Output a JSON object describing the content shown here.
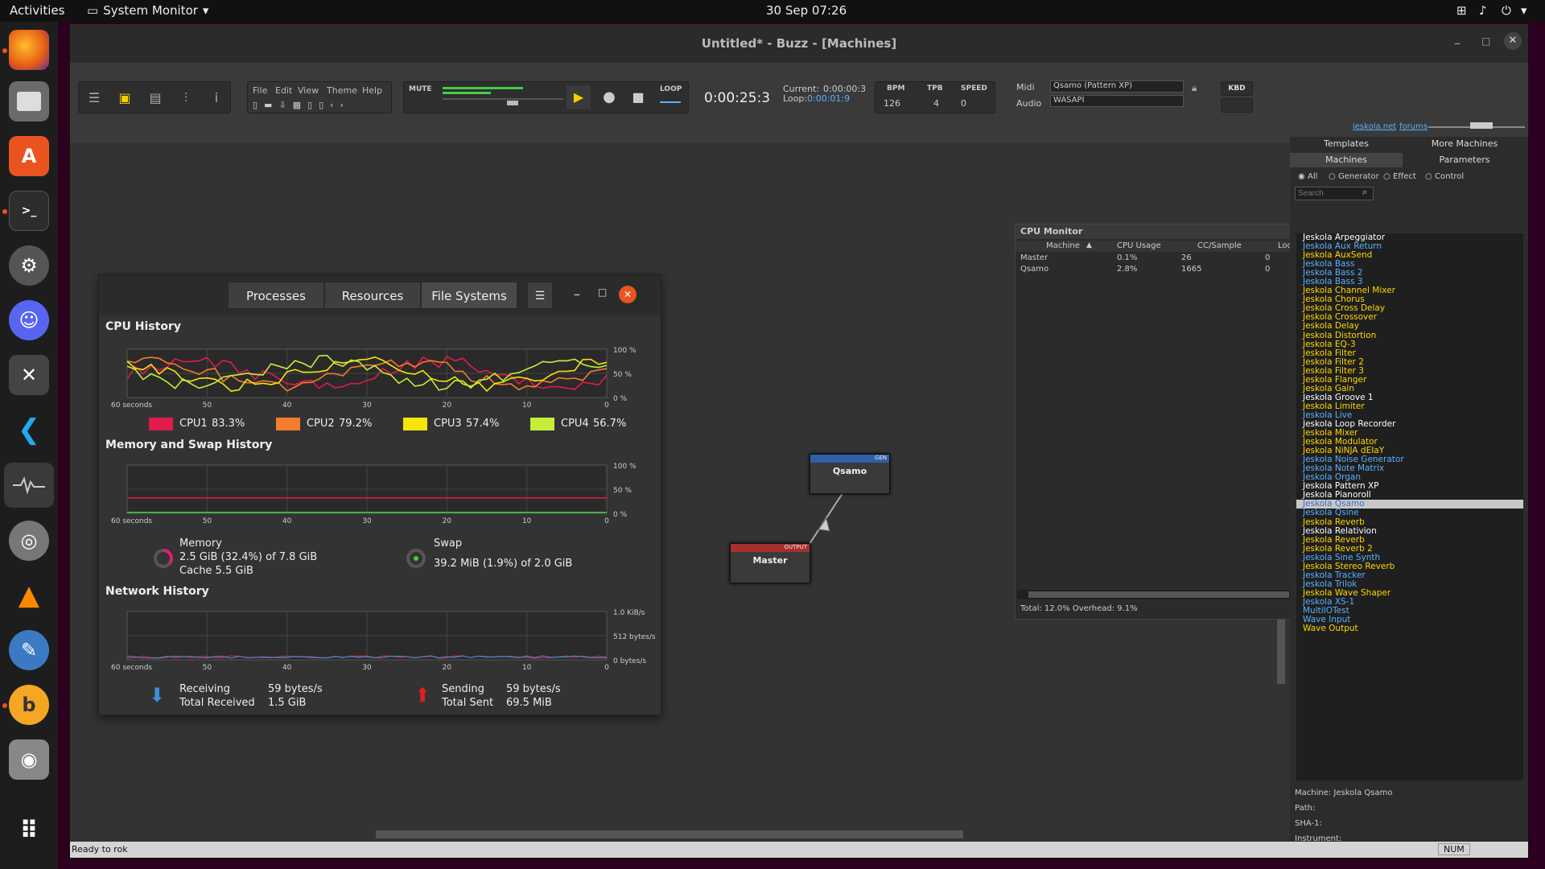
{
  "topbar": {
    "activities": "Activities",
    "app": "System Monitor",
    "datetime": "30 Sep  07:26"
  },
  "dock": {
    "items": [
      "firefox-icon",
      "files-icon",
      "software-icon",
      "terminal-icon",
      "settings-icon",
      "discord-icon",
      "xmind-icon",
      "vscode-icon",
      "system-monitor-icon",
      "lifesaver-icon",
      "vlc-icon",
      "editor-icon",
      "brave-icon",
      "disc-icon"
    ],
    "apps_grid": "apps-grid-icon"
  },
  "buzz": {
    "title": "Untitled* - Buzz - [Machines]",
    "menu": [
      "File",
      "Edit",
      "View",
      "Theme",
      "Help"
    ],
    "mute": "MUTE",
    "loop": "LOOP",
    "time": "0:00:25:3",
    "current_label": "Current:",
    "current": "0:00:00:3",
    "loop_label": "Loop:",
    "loop_time": "0:00:01:9",
    "bpm_label": "BPM",
    "bpm": "126",
    "tpb_label": "TPB",
    "tpb": "4",
    "speed_label": "SPEED",
    "speed": "0",
    "midi_label": "Midi",
    "midi_device": "Qsamo (Pattern XP)",
    "audio_label": "Audio",
    "audio_device": "WASAPI",
    "kbd": "KBD",
    "link1": "jeskola.net",
    "link2": "forums",
    "status": "Ready to rok",
    "num": "NUM"
  },
  "rpanel": {
    "tabs_top": [
      "Templates",
      "More Machines"
    ],
    "tabs": [
      "Machines",
      "Parameters"
    ],
    "filters": [
      "All",
      "Generator",
      "Effect",
      "Control"
    ],
    "search_placeholder": "Search",
    "machines": [
      {
        "n": "Jeskola Arpeggiator",
        "c": "#ffffff"
      },
      {
        "n": "Jeskola Aux Return",
        "c": "#5ab0ff"
      },
      {
        "n": "Jeskola AuxSend",
        "c": "#ffd700"
      },
      {
        "n": "Jeskola Bass",
        "c": "#5ab0ff"
      },
      {
        "n": "Jeskola Bass 2",
        "c": "#5ab0ff"
      },
      {
        "n": "Jeskola Bass 3",
        "c": "#5ab0ff"
      },
      {
        "n": "Jeskola Channel Mixer",
        "c": "#ffd700"
      },
      {
        "n": "Jeskola Chorus",
        "c": "#ffd700"
      },
      {
        "n": "Jeskola Cross Delay",
        "c": "#ffd700"
      },
      {
        "n": "Jeskola Crossover",
        "c": "#ffd700"
      },
      {
        "n": "Jeskola Delay",
        "c": "#ffd700"
      },
      {
        "n": "Jeskola Distortion",
        "c": "#ffd700"
      },
      {
        "n": "Jeskola EQ-3",
        "c": "#ffd700"
      },
      {
        "n": "Jeskola Filter",
        "c": "#ffd700"
      },
      {
        "n": "Jeskola Filter 2",
        "c": "#ffd700"
      },
      {
        "n": "Jeskola Filter 3",
        "c": "#ffd700"
      },
      {
        "n": "Jeskola Flanger",
        "c": "#ffd700"
      },
      {
        "n": "Jeskola Gain",
        "c": "#ffd700"
      },
      {
        "n": "Jeskola Groove 1",
        "c": "#ffffff"
      },
      {
        "n": "Jeskola Limiter",
        "c": "#ffd700"
      },
      {
        "n": "Jeskola Live",
        "c": "#5ab0ff"
      },
      {
        "n": "Jeskola Loop Recorder",
        "c": "#ffffff"
      },
      {
        "n": "Jeskola Mixer",
        "c": "#ffd700"
      },
      {
        "n": "Jeskola Modulator",
        "c": "#ffd700"
      },
      {
        "n": "Jeskola NiNJA dEIaY",
        "c": "#ffd700"
      },
      {
        "n": "Jeskola Noise Generator",
        "c": "#5ab0ff"
      },
      {
        "n": "Jeskola Note Matrix",
        "c": "#5ab0ff"
      },
      {
        "n": "Jeskola Organ",
        "c": "#5ab0ff"
      },
      {
        "n": "Jeskola Pattern XP",
        "c": "#ffffff"
      },
      {
        "n": "Jeskola Pianoroll",
        "c": "#ffffff"
      },
      {
        "n": "Jeskola Qsamo",
        "c": "#5ab0ff",
        "sel": true
      },
      {
        "n": "Jeskola Qsine",
        "c": "#5ab0ff"
      },
      {
        "n": "Jeskola Reverb",
        "c": "#ffd700"
      },
      {
        "n": "Jeskola Relativion",
        "c": "#ffffff"
      },
      {
        "n": "Jeskola Reverb",
        "c": "#ffd700"
      },
      {
        "n": "Jeskola Reverb 2",
        "c": "#ffd700"
      },
      {
        "n": "Jeskola Sine Synth",
        "c": "#5ab0ff"
      },
      {
        "n": "Jeskola Stereo Reverb",
        "c": "#ffd700"
      },
      {
        "n": "Jeskola Tracker",
        "c": "#5ab0ff"
      },
      {
        "n": "Jeskola Trilok",
        "c": "#5ab0ff"
      },
      {
        "n": "Jeskola Wave Shaper",
        "c": "#ffd700"
      },
      {
        "n": "Jeskola XS-1",
        "c": "#5ab0ff"
      },
      {
        "n": "MultiIOTest",
        "c": "#5ab0ff"
      },
      {
        "n": "Wave Input",
        "c": "#5ab0ff"
      },
      {
        "n": "Wave Output",
        "c": "#ffd700"
      }
    ],
    "info": {
      "machine_label": "Machine:",
      "machine": "Jeskola Qsamo",
      "path_label": "Path:",
      "sha_label": "SHA-1:",
      "instrument_label": "Instrument:",
      "path2_label": "Path:"
    }
  },
  "cpumon": {
    "title": "CPU Monitor",
    "headers": [
      "Machine",
      "CPU Usage",
      "CC/Sample",
      "Lock Time (µ"
    ],
    "rows": [
      [
        "Master",
        "0.1%",
        "26",
        "0"
      ],
      [
        "Qsamo",
        "2.8%",
        "1665",
        "0"
      ]
    ],
    "total": "Total: 12.0%   Overhead: 9.1%"
  },
  "machines": {
    "qsamo": "Qsamo",
    "qsamo_tag": "GEN",
    "master": "Master",
    "master_tag": "OUTPUT"
  },
  "sysmon": {
    "tabs": [
      "Processes",
      "Resources",
      "File Systems"
    ],
    "cpu_title": "CPU History",
    "mem_title": "Memory and Swap History",
    "net_title": "Network History",
    "x_ticks": [
      "60 seconds",
      "50",
      "40",
      "30",
      "20",
      "10",
      "0"
    ],
    "pct_ticks": [
      "100 %",
      "50 %",
      "0 %"
    ],
    "net_ticks": [
      "1.0 KiB/s",
      "512 bytes/s",
      "0 bytes/s"
    ],
    "cpu_legend": [
      {
        "name": "CPU1",
        "value": "83.3%",
        "color": "#e01b4c"
      },
      {
        "name": "CPU2",
        "value": "79.2%",
        "color": "#f57c2e"
      },
      {
        "name": "CPU3",
        "value": "57.4%",
        "color": "#f5e50a"
      },
      {
        "name": "CPU4",
        "value": "56.7%",
        "color": "#c4ed3c"
      }
    ],
    "memory": {
      "label": "Memory",
      "line1": "2.5 GiB (32.4%) of 7.8 GiB",
      "line2": "Cache 5.5 GiB"
    },
    "swap": {
      "label": "Swap",
      "line1": "39.2 MiB (1.9%) of 2.0 GiB"
    },
    "net": {
      "recv_label": "Receiving",
      "recv": "59 bytes/s",
      "total_recv_label": "Total Received",
      "total_recv": "1.5 GiB",
      "send_label": "Sending",
      "send": "59 bytes/s",
      "total_sent_label": "Total Sent",
      "total_sent": "69.5 MiB"
    }
  }
}
